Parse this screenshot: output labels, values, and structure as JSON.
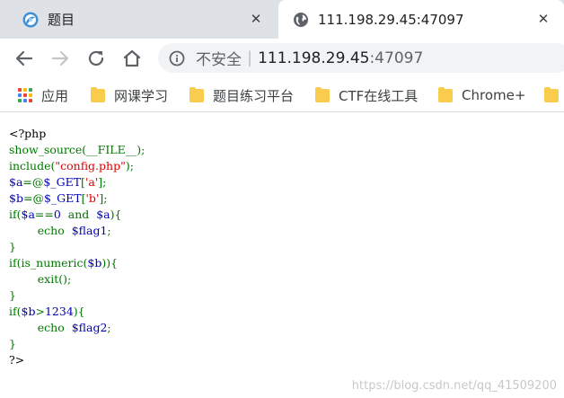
{
  "tabs": [
    {
      "title": "题目",
      "icon": "ctf-favicon-icon",
      "close": "✕",
      "active": false
    },
    {
      "title": "111.198.29.45:47097",
      "icon": "globe-icon",
      "close": "✕",
      "active": true
    }
  ],
  "toolbar": {
    "back_icon": "arrow-left-icon",
    "forward_icon": "arrow-right-icon",
    "reload_icon": "reload-icon",
    "home_icon": "home-icon"
  },
  "omnibox": {
    "security_label": "不安全",
    "separator": "|",
    "url_host": "111.198.29.45",
    "url_port": ":47097"
  },
  "bookmarks": [
    {
      "label": "应用",
      "icon": "apps-grid-icon"
    },
    {
      "label": "网课学习",
      "icon": "folder-icon"
    },
    {
      "label": "题目练习平台",
      "icon": "folder-icon"
    },
    {
      "label": "CTF在线工具",
      "icon": "folder-icon"
    },
    {
      "label": "Chrome+",
      "icon": "folder-icon"
    }
  ],
  "code": {
    "lines": [
      [
        {
          "t": "<?php",
          "c": "default"
        }
      ],
      [
        {
          "t": "show_source(__FILE__);",
          "c": "keyword"
        }
      ],
      [
        {
          "t": "include(",
          "c": "keyword"
        },
        {
          "t": "\"config.php\"",
          "c": "string"
        },
        {
          "t": ");",
          "c": "keyword"
        }
      ],
      [
        {
          "t": "$a",
          "c": "variable"
        },
        {
          "t": "=@",
          "c": "keyword"
        },
        {
          "t": "$_GET",
          "c": "variable"
        },
        {
          "t": "[",
          "c": "keyword"
        },
        {
          "t": "'a'",
          "c": "string"
        },
        {
          "t": "];",
          "c": "keyword"
        }
      ],
      [
        {
          "t": "$b",
          "c": "variable"
        },
        {
          "t": "=@",
          "c": "keyword"
        },
        {
          "t": "$_GET",
          "c": "variable"
        },
        {
          "t": "[",
          "c": "keyword"
        },
        {
          "t": "'b'",
          "c": "string"
        },
        {
          "t": "];",
          "c": "keyword"
        }
      ],
      [
        {
          "t": "if(",
          "c": "keyword"
        },
        {
          "t": "$a",
          "c": "variable"
        },
        {
          "t": "==",
          "c": "keyword"
        },
        {
          "t": "0  ",
          "c": "variable"
        },
        {
          "t": "and  ",
          "c": "keyword"
        },
        {
          "t": "$a",
          "c": "variable"
        },
        {
          "t": "){",
          "c": "keyword"
        }
      ],
      [
        {
          "t": "        echo  ",
          "c": "keyword"
        },
        {
          "t": "$flag1",
          "c": "variable"
        },
        {
          "t": ";",
          "c": "keyword"
        }
      ],
      [
        {
          "t": "}",
          "c": "keyword"
        }
      ],
      [
        {
          "t": "if(is_numeric(",
          "c": "keyword"
        },
        {
          "t": "$b",
          "c": "variable"
        },
        {
          "t": ")){",
          "c": "keyword"
        }
      ],
      [
        {
          "t": "        exit();",
          "c": "keyword"
        }
      ],
      [
        {
          "t": "}",
          "c": "keyword"
        }
      ],
      [
        {
          "t": "if(",
          "c": "keyword"
        },
        {
          "t": "$b",
          "c": "variable"
        },
        {
          "t": ">",
          "c": "keyword"
        },
        {
          "t": "1234",
          "c": "variable"
        },
        {
          "t": "){",
          "c": "keyword"
        }
      ],
      [
        {
          "t": "        echo  ",
          "c": "keyword"
        },
        {
          "t": "$flag2",
          "c": "variable"
        },
        {
          "t": ";",
          "c": "keyword"
        }
      ],
      [
        {
          "t": "}",
          "c": "keyword"
        }
      ],
      [
        {
          "t": "?>",
          "c": "default"
        }
      ]
    ]
  },
  "watermark": "https://blog.csdn.net/qq_41509200",
  "colors": {
    "tabstrip_bg": "#dee1e6",
    "omnibox_bg": "#f1f3f4",
    "folder": "#f9cc4e",
    "php_keyword": "#007700",
    "php_string": "#dd0000",
    "php_variable": "#0000bb"
  }
}
